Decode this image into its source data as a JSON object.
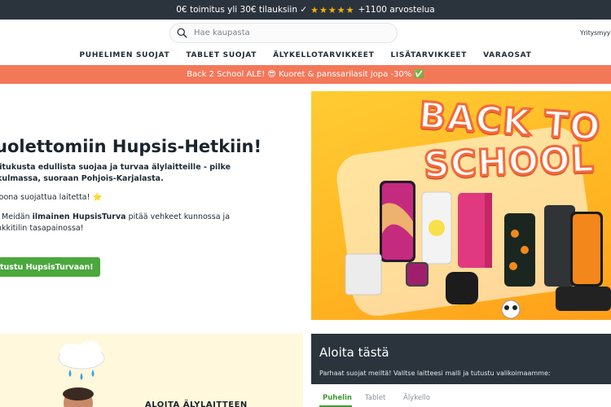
{
  "topbar": {
    "shipping": "0€ toimitus yli 30€ tilauksiin ✓",
    "stars": "★★★★★",
    "reviews": "+1100 arvostelua"
  },
  "header": {
    "search_placeholder": "Hae kaupasta",
    "business_link": "Yritysmyyn"
  },
  "nav": {
    "items": [
      "PUHELIMEN SUOJAT",
      "TABLET SUOJAT",
      "ÄLYKELLOTARVIKKEET",
      "LISÄTARVIKKEET",
      "VARAOSAT"
    ]
  },
  "promo": {
    "text": "Back 2 School ALE! 😎 Kuoret & panssarilasit jopa -30% ✅"
  },
  "hero": {
    "title": "uolettomiin Hupsis-Hetkiin!",
    "p1_line1": "litukusta edullista suojaa ja turvaa älylaitteille - pilke",
    "p1_line2": "kulmassa, suoraan Pohjois-Karjalasta.",
    "p2": "joona suojattua laitetta! ⭐",
    "p3_pre": ". Meidän ",
    "p3_bold": "ilmainen HupsisTurva",
    "p3_post": " pitää vehkeet kunnossa ja",
    "p3_line2": "nkkitilin tasapainossa!",
    "cta": "tustu HupsisTurvaan!"
  },
  "banner": {
    "line1": "BACK TO",
    "line2": "SCHOOL"
  },
  "card_left": {
    "heading": "ALOITA ÄLYLAITTEEN"
  },
  "card_right": {
    "title": "Aloita tästä",
    "subtitle": "Parhaat suojat meiltä! Valitse laitteesi malli ja tutustu valikoimaamme:",
    "tabs": [
      "Puhelin",
      "Tablet",
      "Älykello"
    ]
  },
  "colors": {
    "dark": "#2b343d",
    "promo": "#f3785a",
    "green": "#4aa83c",
    "banner": "#ffbb22"
  }
}
